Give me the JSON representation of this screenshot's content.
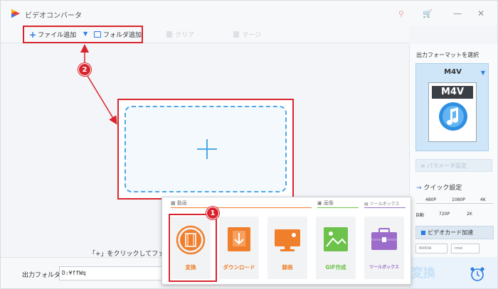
{
  "app": {
    "title": "ビデオコンバータ"
  },
  "titlebar": {
    "window_controls": [
      "key-icon",
      "cart-icon",
      "minimize-icon",
      "close-icon"
    ]
  },
  "toolbar": {
    "add_file_label": "ファイル追加",
    "add_folder_label": "フォルダ追加",
    "clear_label": "クリア",
    "merge_label": "マージ"
  },
  "main": {
    "hint_text": "「+」をクリックしてファイ"
  },
  "badges": {
    "step1": "1",
    "step2": "2"
  },
  "bottom": {
    "output_folder_label": "出力フォルダ：",
    "output_folder_value": "D:¥ffWq"
  },
  "right_panel": {
    "format_title": "出力フォーマットを選択",
    "format_name": "M4V",
    "format_icon_label": "M4V",
    "param_button_label": "パラメータ設定",
    "quick_settings_title": "クイック設定",
    "quality_ticks_top": [
      "480P",
      "1080P",
      "4K"
    ],
    "quality_ticks_bottom": [
      "自動",
      "720P",
      "2K"
    ],
    "gpu_button_label": "ビデオカード加速",
    "gpu_vendors": [
      "NVIDIA",
      "Intel"
    ],
    "convert_label": "変換"
  },
  "popup": {
    "section_video": "動画",
    "section_image": "画像",
    "section_toolbox": "ツールボックス",
    "tools": [
      {
        "label": "変換",
        "color": "#f07f2c"
      },
      {
        "label": "ダウンロード",
        "color": "#f07f2c"
      },
      {
        "label": "録画",
        "color": "#f07f2c"
      },
      {
        "label": "GIF作成",
        "color": "#6cc24a"
      },
      {
        "label": "ツールボックス",
        "color": "#9b6cc9"
      }
    ]
  },
  "colors": {
    "accent": "#2b7de1",
    "highlight": "#d8252d",
    "orange": "#f07f2c",
    "green": "#6cc24a",
    "purple": "#9b6cc9"
  }
}
